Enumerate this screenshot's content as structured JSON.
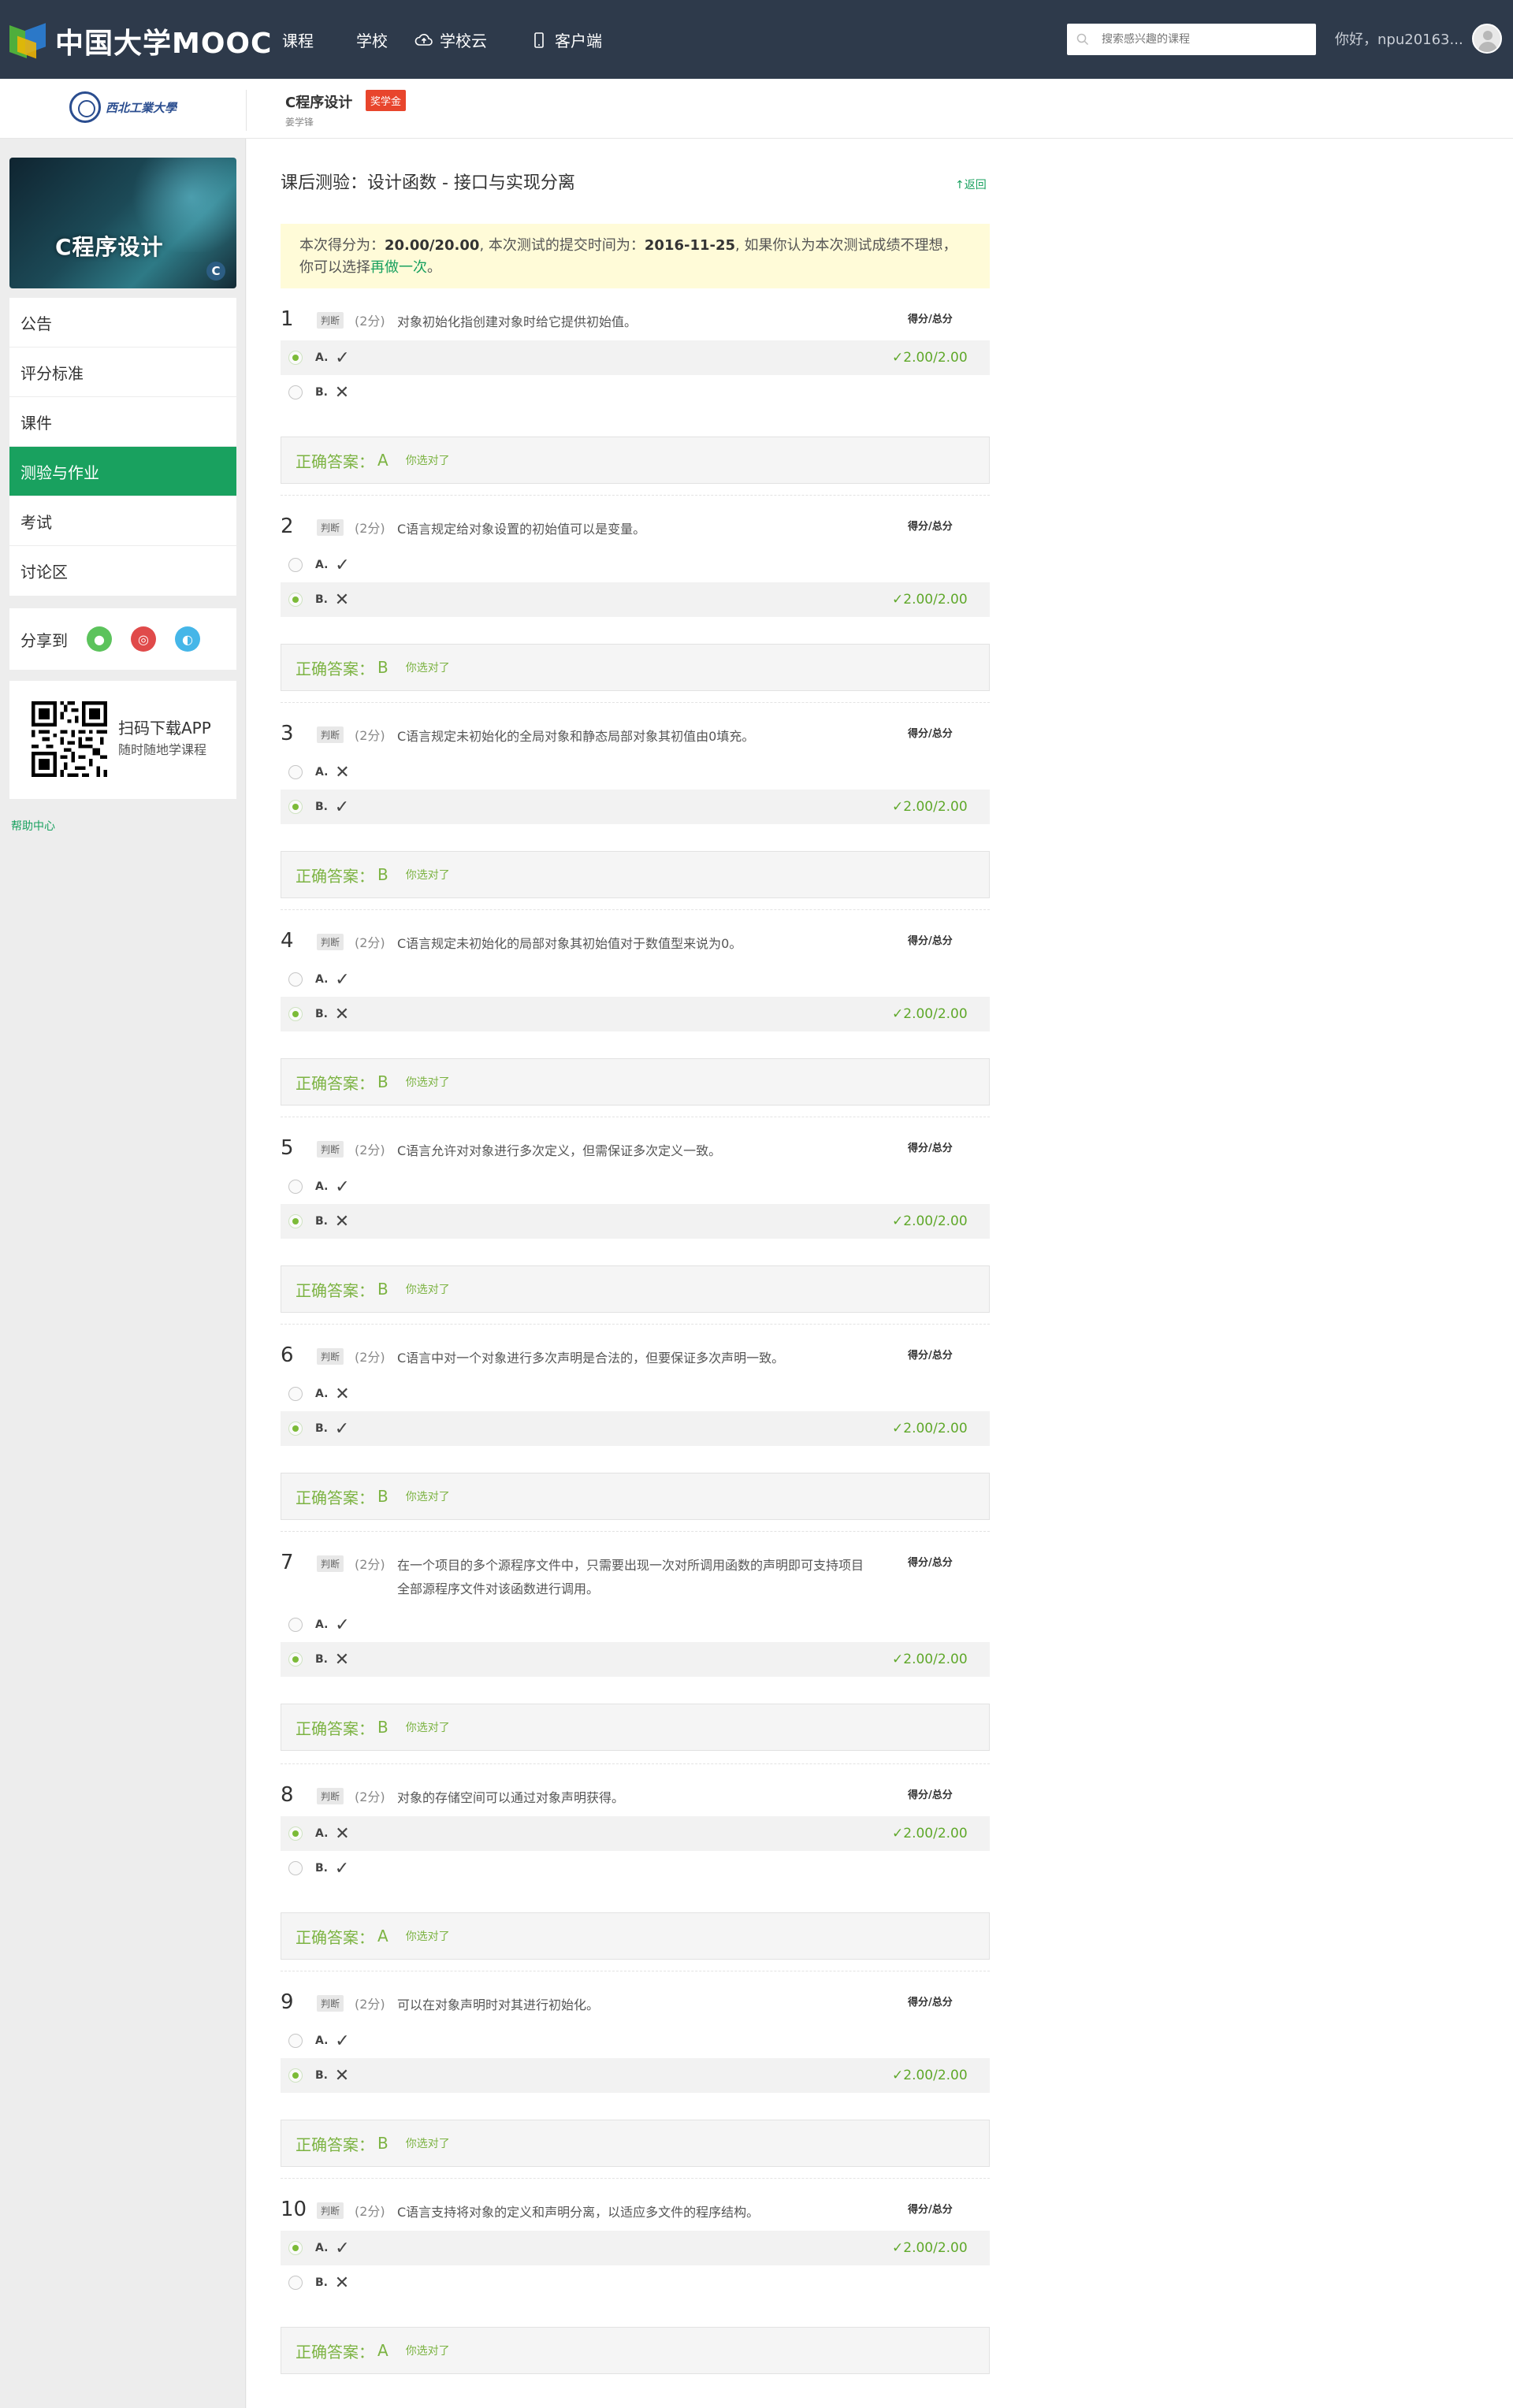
{
  "topnav": {
    "brand": "中国大学MOOC",
    "items": [
      "课程",
      "学校",
      "学校云",
      "客户端"
    ],
    "search_placeholder": "搜索感兴趣的课程",
    "greeting": "你好，npu20163..."
  },
  "course": {
    "school": "西北工業大學",
    "title": "C程序设计",
    "badge": "奖学金",
    "teacher": "姜学锋"
  },
  "sidebar": {
    "banner_text": "C程序设计",
    "banner_badge": "C",
    "menu": [
      "公告",
      "评分标准",
      "课件",
      "测验与作业",
      "考试",
      "讨论区"
    ],
    "active_index": 3,
    "share_label": "分享到",
    "app_title": "扫码下载APP",
    "app_sub": "随时随地学课程",
    "help": "帮助中心"
  },
  "quiz": {
    "title": "课后测验：设计函数 - 接口与实现分离",
    "back": "返回",
    "notice_pre": "本次得分为：",
    "notice_score": "20.00/20.00",
    "notice_mid": ", 本次测试的提交时间为：",
    "notice_time": "2016-11-25",
    "notice_post": ", 如果你认为本次测试成绩不理想，你可以选择",
    "notice_redo": "再做一次",
    "notice_end": "。",
    "score_label": "得分/总分",
    "answer_label": "正确答案：",
    "answer_ok": "你选对了",
    "type_label": "判断",
    "points_label": "(2分)",
    "opt_score": "2.00/2.00",
    "questions": [
      {
        "num": "1",
        "text": "对象初始化指创建对象时给它提供初始值。",
        "options": [
          {
            "letter": "A.",
            "mark": "✓"
          },
          {
            "letter": "B.",
            "mark": "✕"
          }
        ],
        "selected": 0,
        "answer": "A"
      },
      {
        "num": "2",
        "text": "C语言规定给对象设置的初始值可以是变量。",
        "options": [
          {
            "letter": "A.",
            "mark": "✓"
          },
          {
            "letter": "B.",
            "mark": "✕"
          }
        ],
        "selected": 1,
        "answer": "B"
      },
      {
        "num": "3",
        "text": "C语言规定未初始化的全局对象和静态局部对象其初值由0填充。",
        "options": [
          {
            "letter": "A.",
            "mark": "✕"
          },
          {
            "letter": "B.",
            "mark": "✓"
          }
        ],
        "selected": 1,
        "answer": "B"
      },
      {
        "num": "4",
        "text": "C语言规定未初始化的局部对象其初始值对于数值型来说为0。",
        "options": [
          {
            "letter": "A.",
            "mark": "✓"
          },
          {
            "letter": "B.",
            "mark": "✕"
          }
        ],
        "selected": 1,
        "answer": "B"
      },
      {
        "num": "5",
        "text": "C语言允许对对象进行多次定义，但需保证多次定义一致。",
        "options": [
          {
            "letter": "A.",
            "mark": "✓"
          },
          {
            "letter": "B.",
            "mark": "✕"
          }
        ],
        "selected": 1,
        "answer": "B"
      },
      {
        "num": "6",
        "text": "C语言中对一个对象进行多次声明是合法的，但要保证多次声明一致。",
        "options": [
          {
            "letter": "A.",
            "mark": "✕"
          },
          {
            "letter": "B.",
            "mark": "✓"
          }
        ],
        "selected": 1,
        "answer": "B"
      },
      {
        "num": "7",
        "text": "在一个项目的多个源程序文件中，只需要出现一次对所调用函数的声明即可支持项目全部源程序文件对该函数进行调用。",
        "options": [
          {
            "letter": "A.",
            "mark": "✓"
          },
          {
            "letter": "B.",
            "mark": "✕"
          }
        ],
        "selected": 1,
        "answer": "B"
      },
      {
        "num": "8",
        "text": "对象的存储空间可以通过对象声明获得。",
        "options": [
          {
            "letter": "A.",
            "mark": "✕"
          },
          {
            "letter": "B.",
            "mark": "✓"
          }
        ],
        "selected": 0,
        "answer": "A"
      },
      {
        "num": "9",
        "text": "可以在对象声明时对其进行初始化。",
        "options": [
          {
            "letter": "A.",
            "mark": "✓"
          },
          {
            "letter": "B.",
            "mark": "✕"
          }
        ],
        "selected": 1,
        "answer": "B"
      },
      {
        "num": "10",
        "text": "C语言支持将对象的定义和声明分离，以适应多文件的程序结构。",
        "options": [
          {
            "letter": "A.",
            "mark": "✓"
          },
          {
            "letter": "B.",
            "mark": "✕"
          }
        ],
        "selected": 0,
        "answer": "A"
      }
    ]
  },
  "colors": {
    "nav_bg": "#2e3a4b",
    "accent_green": "#19a15f",
    "correct_green": "#7cb342",
    "badge_red": "#e8452c",
    "notice_bg": "#fffbd8"
  }
}
